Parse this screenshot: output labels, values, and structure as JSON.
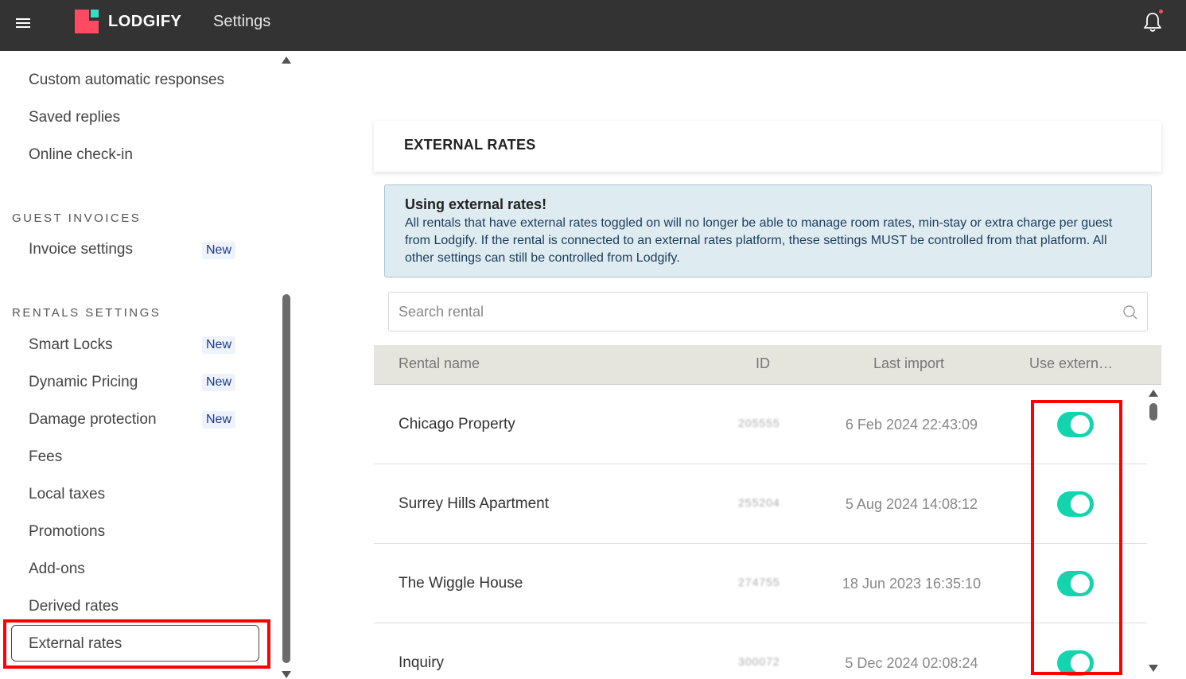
{
  "header": {
    "brand": "LODGIFY",
    "title": "Settings"
  },
  "sidebar": {
    "items_top": [
      {
        "label": "Custom automatic responses"
      },
      {
        "label": "Saved replies"
      },
      {
        "label": "Online check-in"
      }
    ],
    "guest_invoices": {
      "title": "GUEST INVOICES",
      "items": [
        {
          "label": "Invoice settings",
          "badge": "New"
        }
      ]
    },
    "rentals_settings": {
      "title": "RENTALS SETTINGS",
      "items": [
        {
          "label": "Smart Locks",
          "badge": "New"
        },
        {
          "label": "Dynamic Pricing",
          "badge": "New"
        },
        {
          "label": "Damage protection",
          "badge": "New"
        },
        {
          "label": "Fees"
        },
        {
          "label": "Local taxes"
        },
        {
          "label": "Promotions"
        },
        {
          "label": "Add-ons"
        },
        {
          "label": "Derived rates"
        },
        {
          "label": "External rates"
        }
      ]
    }
  },
  "main": {
    "card_title": "EXTERNAL RATES",
    "info": {
      "title": "Using external rates!",
      "text": "All rentals that have external rates toggled on will no longer be able to manage room rates, min-stay or extra charge per guest from Lodgify. If the rental is connected to an external rates platform, these settings MUST be controlled from that platform. All other settings can still be controlled from Lodgify."
    },
    "search": {
      "placeholder": "Search rental"
    },
    "table": {
      "columns": [
        "Rental name",
        "ID",
        "Last import",
        "Use extern…"
      ],
      "rows": [
        {
          "name": "Chicago Property",
          "id": "205555",
          "last_import": "6 Feb 2024 22:43:09",
          "use_external": true
        },
        {
          "name": "Surrey Hills Apartment",
          "id": "255204",
          "last_import": "5 Aug 2024 14:08:12",
          "use_external": true
        },
        {
          "name": "The Wiggle House",
          "id": "274755",
          "last_import": "18 Jun 2023 16:35:10",
          "use_external": true
        },
        {
          "name": "Inquiry",
          "id": "300072",
          "last_import": "5 Dec 2024 02:08:24",
          "use_external": true
        }
      ]
    }
  },
  "colors": {
    "topbar": "#333333",
    "brand_red": "#ff4a62",
    "toggle_on": "#13d4ae",
    "highlight": "#ff0000",
    "info_bg": "#deebf0"
  }
}
